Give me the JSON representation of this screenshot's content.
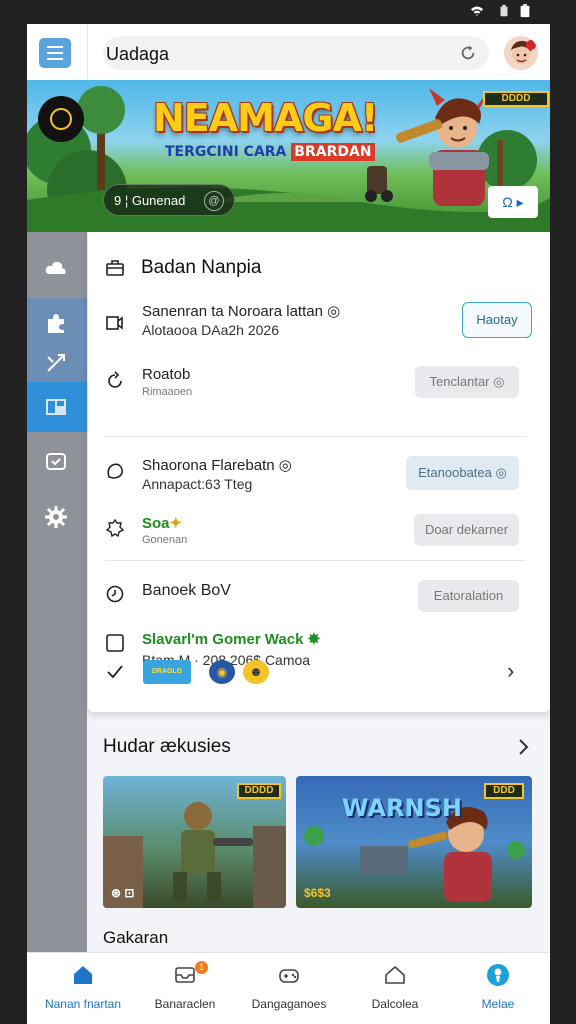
{
  "status_bar": {
    "icons": [
      "wifi-icon",
      "battery-saver-icon",
      "battery-icon"
    ]
  },
  "header": {
    "search_text": "Uadaga",
    "icons": {
      "menu": "menu-icon",
      "reload": "reload-icon",
      "avatar": "avatar"
    }
  },
  "banner": {
    "title": "NEAMAGA!",
    "subtitle_a": "TERGCINI CARA",
    "subtitle_b": "BRARDAN",
    "pill_text": "9 ¦ Gunenad",
    "pill_badge": "@",
    "tag": "DDDD",
    "button_label": "Ω ▸"
  },
  "sidebar": {
    "items": [
      {
        "icon": "cloud-icon"
      },
      {
        "icon": "puzzle-icon"
      },
      {
        "icon": "split-arrow-icon"
      },
      {
        "icon": "grid-icon"
      },
      {
        "icon": "chat-icon"
      },
      {
        "icon": "gear-icon"
      }
    ]
  },
  "card": {
    "title": "Badan Nanpia",
    "rows": [
      {
        "title": "Sanenran ta Noroara lattan ◎",
        "sub": "Alotaooa DAa2h 2026",
        "button": "Haotay"
      },
      {
        "title": "Roatob",
        "sub": "Rimaaoen",
        "button": "Tenclantar ◎"
      },
      {
        "title": "Shaorona Flarebatn ◎",
        "sub": "Annapact:63 Tteg",
        "button": "Etanoobatea ◎"
      },
      {
        "title": "Soa",
        "title_emoji": "✦",
        "sub": "Gonenan",
        "button": "Doar dekarner"
      },
      {
        "title": "Banoek BoV",
        "sub": "",
        "button": "Eatoralation"
      },
      {
        "title": "Slavarl'm Gomer Wack ✸",
        "sub": "Btam M · 208 206$ Camoa",
        "button": ""
      }
    ],
    "chips": {
      "chip_a": "DRAGLG",
      "chip_b": "◉",
      "chip_c": "☻",
      "chevron": "›"
    }
  },
  "section": {
    "title": "Hudar ækusies",
    "thumbs": [
      {
        "tag": "DDDD",
        "bottom": "⊛ ⊡"
      },
      {
        "title": "WARNSH",
        "tag": "DDD",
        "bottom": "$6$3"
      }
    ],
    "next_title": "Gakaran"
  },
  "bottom_nav": {
    "items": [
      {
        "label": "Nanan fnartan",
        "icon": "home-icon",
        "active": true
      },
      {
        "label": "Banaraclen",
        "icon": "inbox-icon",
        "badge": "1"
      },
      {
        "label": "Dangaganoes",
        "icon": "game-controller-icon"
      },
      {
        "label": "Dalcolea",
        "icon": "house-outline-icon"
      },
      {
        "label": "Melae",
        "icon": "profile-icon",
        "active": true
      }
    ]
  },
  "colors": {
    "accent": "#1c76c9",
    "sidebar_active": "#2f8fd8",
    "button_outline": "#3aa5d9"
  }
}
